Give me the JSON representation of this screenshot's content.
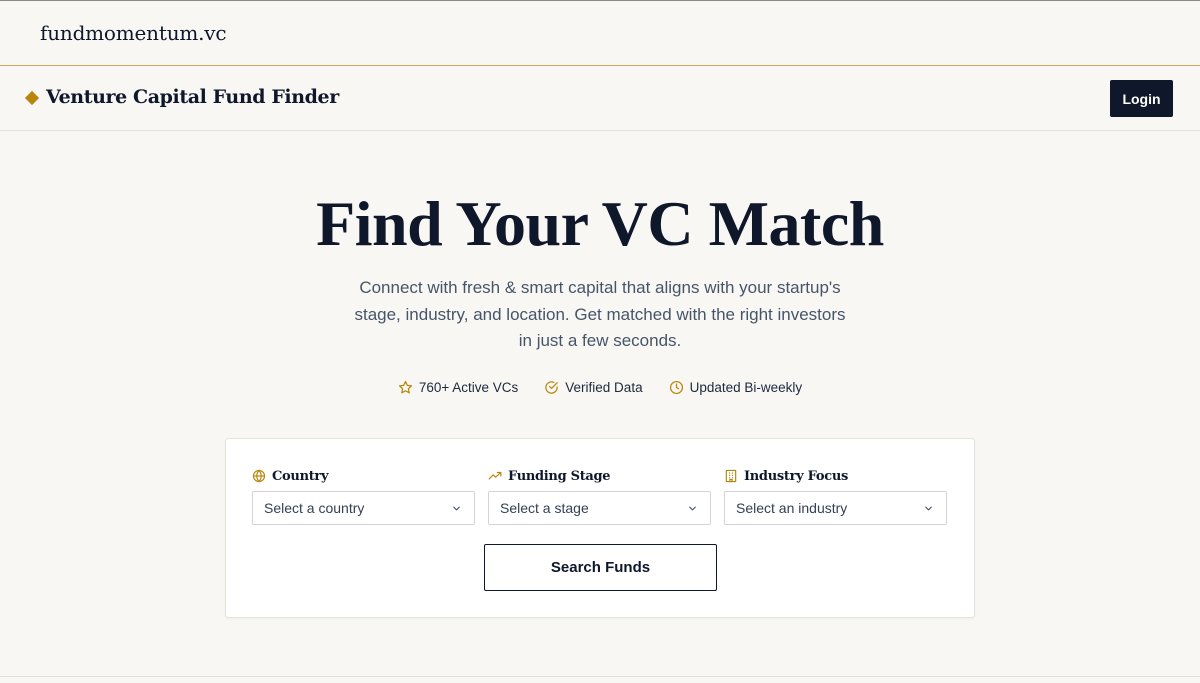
{
  "site": {
    "domain": "fundmomentum.vc"
  },
  "header": {
    "brand": "Venture Capital Fund Finder",
    "login_label": "Login",
    "brand_mark_icon": "diamond-icon",
    "accent_color": "#b8860b",
    "navy_color": "#0f172a"
  },
  "hero": {
    "title": "Find Your VC Match",
    "subtitle": "Connect with fresh & smart capital that aligns with your startup's stage, industry, and location. Get matched with the right investors in just a few seconds.",
    "badges": [
      {
        "icon": "star-icon",
        "label": "760+ Active VCs"
      },
      {
        "icon": "check-circle-icon",
        "label": "Verified Data"
      },
      {
        "icon": "clock-icon",
        "label": "Updated Bi-weekly"
      }
    ]
  },
  "search": {
    "fields": [
      {
        "icon": "globe-icon",
        "label": "Country",
        "value": "Select a country"
      },
      {
        "icon": "trending-up-icon",
        "label": "Funding Stage",
        "value": "Select a stage"
      },
      {
        "icon": "building-icon",
        "label": "Industry Focus",
        "value": "Select an industry"
      }
    ],
    "button_label": "Search Funds"
  }
}
